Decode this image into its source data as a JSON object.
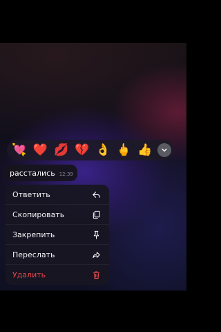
{
  "reactions": [
    {
      "emoji": "💘",
      "icon": "heart-with-arrow-icon"
    },
    {
      "emoji": "❤️",
      "icon": "red-heart-icon"
    },
    {
      "emoji": "💋",
      "icon": "kiss-mark-icon"
    },
    {
      "emoji": "💔",
      "icon": "broken-heart-icon"
    },
    {
      "emoji": "👌",
      "icon": "ok-hand-icon"
    },
    {
      "emoji": "🖕",
      "icon": "middle-finger-icon"
    },
    {
      "emoji": "👍",
      "icon": "thumbs-up-icon"
    }
  ],
  "message": {
    "text": "расстались",
    "time": "12:39"
  },
  "menu": {
    "reply": "Ответить",
    "copy": "Скопировать",
    "pin": "Закрепить",
    "forward": "Переслать",
    "delete": "Удалить"
  },
  "colors": {
    "danger": "#e5484d",
    "background": "#000000",
    "accent": "#4b2ca8"
  }
}
